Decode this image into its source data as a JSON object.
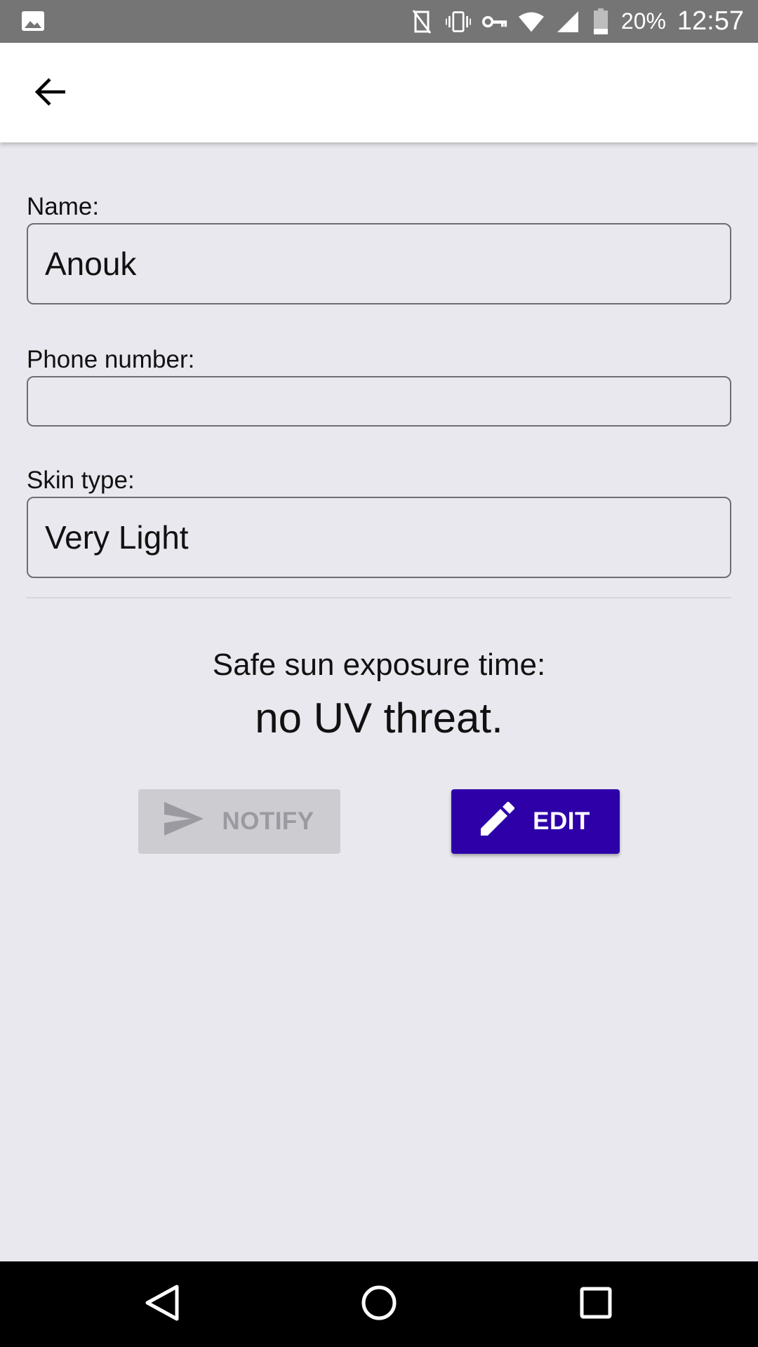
{
  "status_bar": {
    "battery": "20%",
    "time": "12:57",
    "icons": [
      "image-icon",
      "nfc-off-icon",
      "vibrate-icon",
      "vpn-key-icon",
      "wifi-icon",
      "signal-icon",
      "battery-icon"
    ]
  },
  "app_bar": {
    "back_icon": "arrow-back-icon"
  },
  "form": {
    "name_label": "Name:",
    "name_value": "Anouk",
    "phone_label": "Phone number:",
    "phone_value": "",
    "skin_label": "Skin type:",
    "skin_value": "Very Light"
  },
  "exposure": {
    "label": "Safe sun exposure time:",
    "value": "no UV threat."
  },
  "actions": {
    "notify_label": "NOTIFY",
    "notify_icon": "send-icon",
    "notify_enabled": false,
    "edit_label": "EDIT",
    "edit_icon": "pencil-icon"
  },
  "colors": {
    "accent": "#2d00a8",
    "background": "#e9e8ee",
    "status_bar": "#757575",
    "disabled_button": "#cdccd1"
  },
  "nav_bar": {
    "icons": [
      "nav-back-icon",
      "nav-home-icon",
      "nav-recents-icon"
    ]
  }
}
